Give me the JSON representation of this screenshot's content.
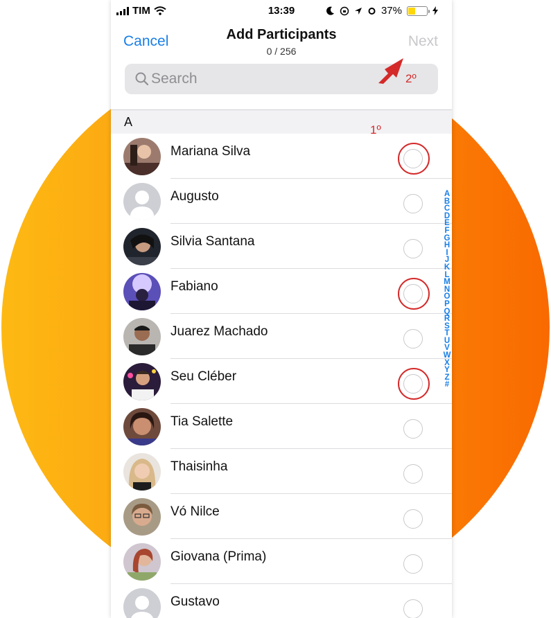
{
  "status_bar": {
    "carrier": "TIM",
    "time": "13:39",
    "battery": "37%"
  },
  "nav": {
    "cancel": "Cancel",
    "title": "Add Participants",
    "count": "0 / 256",
    "next": "Next"
  },
  "search": {
    "placeholder": "Search"
  },
  "section": {
    "label": "A"
  },
  "contacts": [
    {
      "name": "Mariana Silva",
      "highlighted": true
    },
    {
      "name": "Augusto",
      "highlighted": false
    },
    {
      "name": "Silvia Santana",
      "highlighted": false
    },
    {
      "name": "Fabiano",
      "highlighted": true
    },
    {
      "name": "Juarez Machado",
      "highlighted": false
    },
    {
      "name": "Seu Cléber",
      "highlighted": true
    },
    {
      "name": "Tia Salette",
      "highlighted": false
    },
    {
      "name": "Thaisinha",
      "highlighted": false
    },
    {
      "name": "Vó Nilce",
      "highlighted": false
    },
    {
      "name": "Giovana (Prima)",
      "highlighted": false
    },
    {
      "name": "Gustavo",
      "highlighted": false
    }
  ],
  "index_letters": [
    "A",
    "B",
    "C",
    "D",
    "E",
    "F",
    "G",
    "H",
    "I",
    "J",
    "K",
    "L",
    "M",
    "N",
    "O",
    "P",
    "Q",
    "R",
    "S",
    "T",
    "U",
    "V",
    "W",
    "X",
    "Y",
    "Z",
    "#"
  ],
  "annotations": {
    "step1": "1º",
    "step2": "2º"
  },
  "colors": {
    "accent": "#1a7fe6",
    "annotation": "#d42a2a",
    "background_gradient": [
      "#fdb913",
      "#f96a00"
    ]
  }
}
